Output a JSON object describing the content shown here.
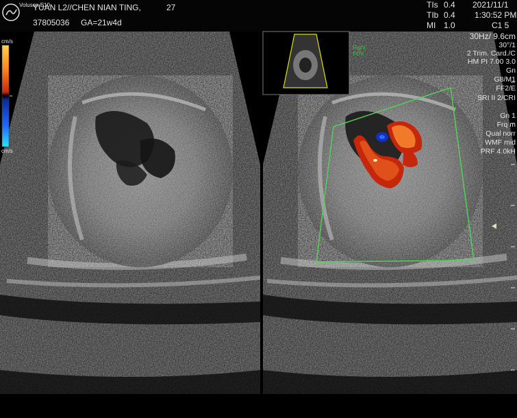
{
  "header": {
    "logo_text": "Voluson E10",
    "patient": "YUAN L2//CHEN NIAN TING,",
    "age": "27",
    "id": "37805036",
    "ga": "GA=21w4d",
    "tis_label": "TIs",
    "tis_value": "0.4",
    "tib_label": "TIb",
    "tib_value": "0.4",
    "mi_label": "MI",
    "mi_value": "1.0",
    "date": "2021/11/1",
    "time": "1:30:52 PM",
    "probe": "C1 5"
  },
  "color_scale": {
    "top_label": "cm/s",
    "bottom_label": "cm/s",
    "colors": [
      "#ffd24a",
      "#ff8a1e",
      "#c92a0a",
      "#000000",
      "#0a2a9a",
      "#1e6cff",
      "#2fe1ff"
    ]
  },
  "settings": {
    "frame": "30Hz/ 9.6cm",
    "angle": "30°/1",
    "preset": "2 Trim. Card./C",
    "hm": "HM PI 7.00  3.0",
    "gn": "Gn",
    "g_m": "G8/M1",
    "ff": "FF2/E",
    "sri": "SRI II 2/CRI",
    "cfm_gn": "Gn  1",
    "frq": "Frq m",
    "qual": "Qual norr",
    "wmf": "WMF mid",
    "prf": "PRF  4.0kH"
  },
  "thumbnail": {
    "label_line1": "Right",
    "label_line2": "FOV"
  }
}
